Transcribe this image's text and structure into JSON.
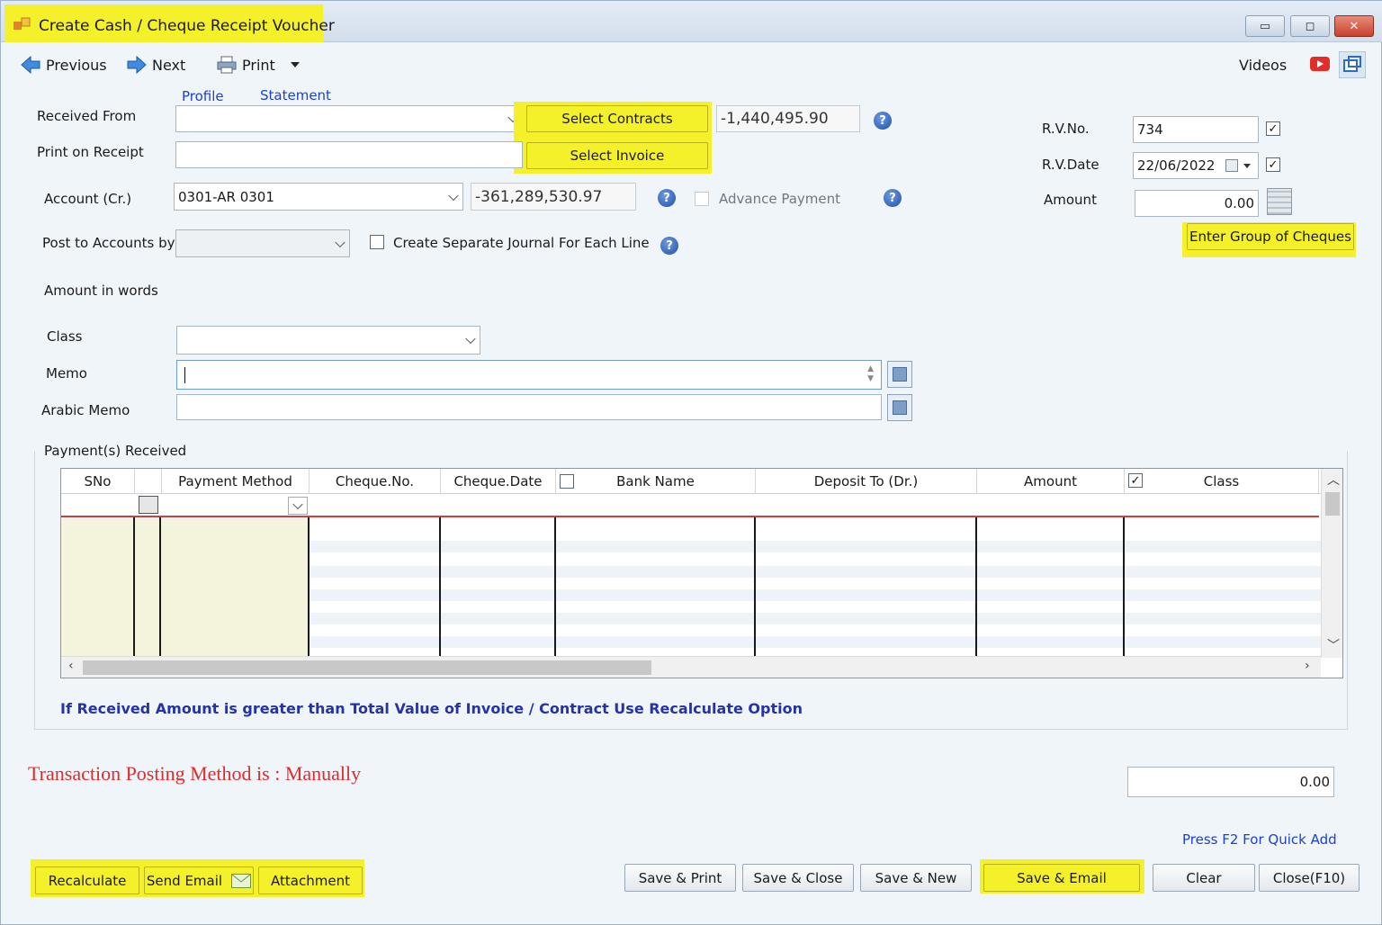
{
  "window": {
    "title": "Create Cash / Cheque Receipt Voucher",
    "minimize_symbol": "▭",
    "maximize_symbol": "◻",
    "close_symbol": "✕"
  },
  "toolbar": {
    "previous_label": "Previous",
    "next_label": "Next",
    "print_label": "Print",
    "videos_label": "Videos"
  },
  "links": {
    "profile": "Profile",
    "statement": "Statement"
  },
  "form": {
    "received_from_label": "Received From",
    "received_from_value": "",
    "select_contracts_label": "Select Contracts",
    "select_invoice_label": "Select Invoice",
    "received_from_balance": "-1,440,495.90",
    "print_on_receipt_label": "Print on Receipt",
    "print_on_receipt_value": "",
    "account_label": "Account (Cr.)",
    "account_value": "0301-AR 0301",
    "account_balance": "-361,289,530.97",
    "advance_payment_label": "Advance Payment",
    "post_to_accounts_label": "Post to Accounts by",
    "post_to_accounts_value": "",
    "separate_journal_label": "Create Separate Journal For Each Line",
    "amount_in_words_label": "Amount in words",
    "class_label": "Class",
    "class_value": "",
    "memo_label": "Memo",
    "memo_value": "",
    "arabic_memo_label": "Arabic Memo",
    "arabic_memo_value": "",
    "rv_no_label": "R.V.No.",
    "rv_no_value": "734",
    "rv_no_checked": true,
    "rv_date_label": "R.V.Date",
    "rv_date_value": "22/06/2022",
    "rv_date_checked": true,
    "amount_label": "Amount",
    "amount_value": "0.00",
    "enter_group_label": "Enter Group of Cheques",
    "help_symbol": "?"
  },
  "payments": {
    "section_label": "Payment(s) Received",
    "columns": [
      "SNo",
      "Payment Method",
      "Cheque.No.",
      "Cheque.Date",
      "Bank Name",
      "Deposit To (Dr.)",
      "Amount",
      "Class"
    ],
    "cheque_date_checked": false,
    "amount_checked": true
  },
  "note_text": "If Received Amount is greater than Total Value of Invoice / Contract Use Recalculate Option",
  "posting_text": "Transaction Posting Method is : Manually",
  "total_value": "0.00",
  "quick_add_text": "Press F2 For Quick Add",
  "footer": {
    "recalculate": "Recalculate",
    "send_email": "Send Email",
    "attachment": "Attachment",
    "save_print": "Save & Print",
    "save_close": "Save & Close",
    "save_new": "Save & New",
    "save_email": "Save & Email",
    "clear": "Clear",
    "close": "Close(F10)"
  },
  "colors": {
    "highlight": "#f4f12a",
    "link": "#1c3fd6",
    "note": "#2632a8",
    "posting": "#e12b2b",
    "grid_red_line": "#d63a3a"
  }
}
